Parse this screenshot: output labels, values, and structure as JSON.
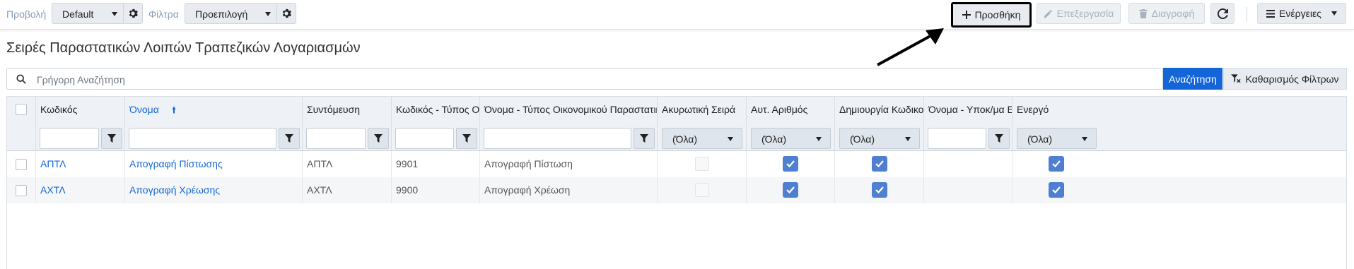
{
  "toolbar": {
    "view_label": "Προβολή",
    "view_value": "Default",
    "filter_label": "Φίλτρα",
    "filter_value": "Προεπιλογή",
    "add_label": "Προσθήκη",
    "edit_label": "Επεξεργασία",
    "delete_label": "Διαγραφή",
    "actions_label": "Ενέργειες"
  },
  "page": {
    "title": "Σειρές Παραστατικών Λοιπών Τραπεζικών Λογαριασμών"
  },
  "search": {
    "placeholder": "Γρήγορη Αναζήτηση",
    "search_button": "Αναζήτηση",
    "clear_button": "Καθαρισμός Φίλτρων"
  },
  "grid": {
    "columns": [
      {
        "label": "Κωδικός"
      },
      {
        "label": "Όνομα",
        "sorted": "asc"
      },
      {
        "label": "Συντόμευση"
      },
      {
        "label": "Κωδικός - Τύπος Οι..."
      },
      {
        "label": "Όνομα - Τύπος Οικονομικού Παραστατικού"
      },
      {
        "label": "Ακυρωτική Σειρά"
      },
      {
        "label": "Αυτ. Αριθμός"
      },
      {
        "label": "Δημιουργία Κωδικού"
      },
      {
        "label": "Όνομα - Υποκ/μα Ε..."
      },
      {
        "label": "Ενεργό"
      }
    ],
    "filter_select_value": "(Όλα)",
    "rows": [
      {
        "code": "ΑΠΤΛ",
        "name": "Απογραφή Πίστωσης",
        "shortcut": "ΑΠΤΛ",
        "doc_type_code": "9901",
        "doc_type_name": "Απογραφή Πίστωση",
        "cancel_series": false,
        "auto_number": true,
        "create_code": true,
        "sub_name": "",
        "active": true
      },
      {
        "code": "ΑΧΤΛ",
        "name": "Απογραφή Χρέωσης",
        "shortcut": "ΑΧΤΛ",
        "doc_type_code": "9900",
        "doc_type_name": "Απογραφή Χρέωση",
        "cancel_series": false,
        "auto_number": true,
        "create_code": true,
        "sub_name": "",
        "active": true
      }
    ]
  },
  "colors": {
    "accent": "#1466d8",
    "checkbox": "#4f7fd1",
    "header_bg": "#eef2f6"
  }
}
